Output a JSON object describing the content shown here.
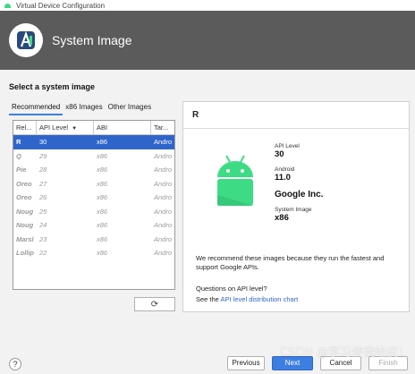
{
  "window": {
    "title": "Virtual Device Configuration"
  },
  "header": {
    "title": "System Image",
    "logo_icon": "android-studio-icon"
  },
  "section_title": "Select a system image",
  "tabs": [
    {
      "label": "Recommended",
      "active": true
    },
    {
      "label": "x86 Images",
      "active": false
    },
    {
      "label": "Other Images",
      "active": false
    }
  ],
  "table": {
    "headers": [
      "Rel...",
      "API Level",
      "ABI",
      "Tar..."
    ],
    "sort_icon": "sort-desc-icon",
    "rows": [
      {
        "release": "R",
        "api": "30",
        "abi": "x86",
        "target": "Andro",
        "selected": true
      },
      {
        "release": "Q",
        "api": "29",
        "abi": "x86",
        "target": "Andro",
        "selected": false
      },
      {
        "release": "Pie",
        "api": "28",
        "abi": "x86",
        "target": "Andro",
        "selected": false
      },
      {
        "release": "Oreo",
        "api": "27",
        "abi": "x86",
        "target": "Andro",
        "selected": false
      },
      {
        "release": "Oreo",
        "api": "26",
        "abi": "x86",
        "target": "Andro",
        "selected": false
      },
      {
        "release": "Noug",
        "api": "25",
        "abi": "x86",
        "target": "Andro",
        "selected": false
      },
      {
        "release": "Noug",
        "api": "24",
        "abi": "x86",
        "target": "Andro",
        "selected": false
      },
      {
        "release": "Marsl",
        "api": "23",
        "abi": "x86",
        "target": "Andro",
        "selected": false
      },
      {
        "release": "Lollip",
        "api": "22",
        "abi": "x86",
        "target": "Andro",
        "selected": false
      }
    ]
  },
  "refresh_icon": "refresh-icon",
  "detail": {
    "title": "R",
    "api_level_label": "API Level",
    "api_level": "30",
    "android_label": "Android",
    "android_version": "11.0",
    "vendor": "Google Inc.",
    "system_image_label": "System Image",
    "system_image": "x86",
    "recommendation": "We recommend these images because they run the fastest and support Google APIs.",
    "question": "Questions on API level?",
    "see_prefix": "See the ",
    "link": "API level distribution chart",
    "robot_icon": "android-robot-icon"
  },
  "footer": {
    "help": "?",
    "previous": "Previous",
    "next": "Next",
    "cancel": "Cancel",
    "finish": "Finish"
  },
  "watermark": "CSDN @学习使我哈皮！",
  "colors": {
    "accent": "#3d7fe0",
    "selection": "#2f65ca",
    "header_bg": "#5b5b5b",
    "android_green": "#3ddc84"
  }
}
